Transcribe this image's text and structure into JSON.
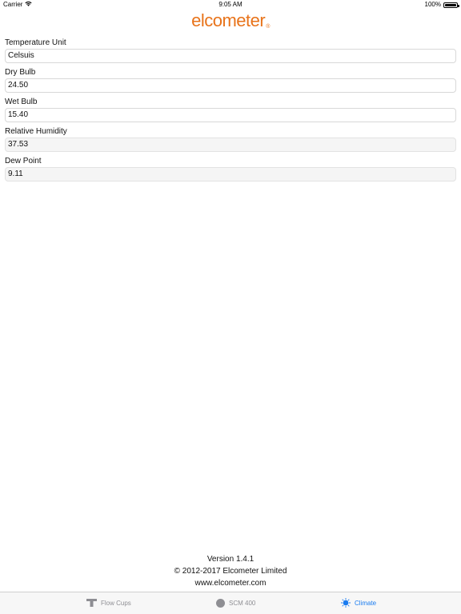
{
  "status_bar": {
    "carrier": "Carrier",
    "time": "9:05 AM",
    "battery": "100%"
  },
  "brand": {
    "logo_text": "elcometer",
    "registered_mark": "®",
    "color": "#e8731a"
  },
  "fields": [
    {
      "label": "Temperature Unit",
      "value": "Celsuis",
      "editable": true
    },
    {
      "label": "Dry Bulb",
      "value": "24.50",
      "editable": true
    },
    {
      "label": "Wet Bulb",
      "value": "15.40",
      "editable": true
    },
    {
      "label": "Relative Humidity",
      "value": "37.53",
      "editable": false
    },
    {
      "label": "Dew Point",
      "value": "9.11",
      "editable": false
    }
  ],
  "footer": {
    "version": "Version 1.4.1",
    "copyright": "© 2012-2017 Elcometer Limited",
    "website": "www.elcometer.com"
  },
  "tabs": [
    {
      "label": "Flow Cups",
      "icon": "flow-cup-icon",
      "active": false
    },
    {
      "label": "SCM 400",
      "icon": "scm-circle-icon",
      "active": false
    },
    {
      "label": "Climate",
      "icon": "sun-icon",
      "active": true
    }
  ],
  "colors": {
    "tab_active": "#1a7cf0",
    "tab_inactive": "#8e8e93"
  }
}
